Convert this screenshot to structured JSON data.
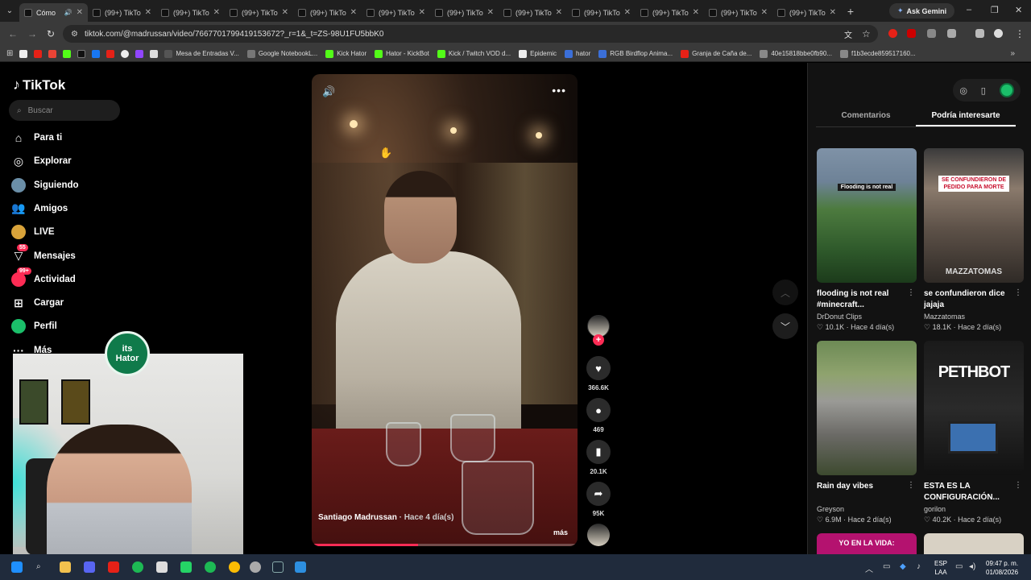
{
  "browser": {
    "tabs": [
      {
        "label": "Cómo"
      },
      {
        "label": "(99+) TikTo"
      },
      {
        "label": "(99+) TikTo"
      },
      {
        "label": "(99+) TikTo"
      },
      {
        "label": "(99+) TikTo"
      },
      {
        "label": "(99+) TikTo"
      },
      {
        "label": "(99+) TikTo"
      },
      {
        "label": "(99+) TikTo"
      },
      {
        "label": "(99+) TikTo"
      },
      {
        "label": "(99+) TikTo"
      },
      {
        "label": "(99+) TikTo"
      },
      {
        "label": "(99+) TikTo"
      }
    ],
    "gemini_label": "Ask Gemini",
    "url": "tiktok.com/@madrussan/video/7667701799419153672?_r=1&_t=ZS-98U1FU5bbK0",
    "bookmarks": [
      {
        "label": "Mesa de Entradas V...",
        "color": "#555555"
      },
      {
        "label": "Google NotebookL...",
        "color": "#777777"
      },
      {
        "label": "Kick Hator",
        "color": "#53fc18"
      },
      {
        "label": "Hator - KickBot",
        "color": "#53fc18"
      },
      {
        "label": "Kick / Twitch VOD d...",
        "color": "#53fc18"
      },
      {
        "label": "Epidemic",
        "color": "#eeeeee"
      },
      {
        "label": "hator",
        "color": "#3b6fd8"
      },
      {
        "label": "RGB Birdflop Anima...",
        "color": "#3b6fd8"
      },
      {
        "label": "Granja de Caña de...",
        "color": "#e62117"
      },
      {
        "label": "40e15818bbe0fb90...",
        "color": "#888888"
      },
      {
        "label": "f1b3ecde859517160...",
        "color": "#888888"
      }
    ]
  },
  "sidebar": {
    "brand": "TikTok",
    "search_placeholder": "Buscar",
    "items": [
      {
        "label": "Para ti",
        "icon": "home-icon"
      },
      {
        "label": "Explorar",
        "icon": "compass-icon"
      },
      {
        "label": "Siguiendo",
        "icon": "following-avatar-icon"
      },
      {
        "label": "Amigos",
        "icon": "friends-icon"
      },
      {
        "label": "LIVE",
        "icon": "live-icon"
      },
      {
        "label": "Mensajes",
        "icon": "messages-icon",
        "badge": "55"
      },
      {
        "label": "Actividad",
        "icon": "activity-icon",
        "badge": "99+"
      },
      {
        "label": "Cargar",
        "icon": "upload-icon"
      },
      {
        "label": "Perfil",
        "icon": "profile-icon"
      },
      {
        "label": "Más",
        "icon": "more-icon"
      }
    ]
  },
  "video": {
    "author": "Santiago Madrussan",
    "ago": "· Hace 4 día(s)",
    "more_label": "más",
    "progress": 0.4,
    "likes": "366.6K",
    "comments": "469",
    "saves": "20.1K",
    "shares": "95K"
  },
  "right_panel": {
    "tabs": [
      "Comentarios",
      "Podría interesarte"
    ],
    "active_tab": 1,
    "cards": [
      {
        "title": "flooding is not real #minecraft...",
        "author": "DrDonut Clips",
        "likes": "10.1K",
        "ago": "Hace 4 día(s)",
        "overlay": "Flooding is not real"
      },
      {
        "title": "se confundieron dice jajaja",
        "author": "Mazzatomas",
        "likes": "18.1K",
        "ago": "Hace 2 día(s)",
        "overlay": "SE CONFUNDIERON DE PEDIDO PARA MORTE",
        "watermark": "MAZZATOMAS"
      },
      {
        "title": "Rain day vibes",
        "author": "Greyson",
        "likes": "6.9M",
        "ago": "Hace 2 día(s)"
      },
      {
        "title": "ESTA ES LA CONFIGURACIÓN...",
        "author": "gorilon",
        "likes": "40.2K",
        "ago": "Hace 2 día(s)",
        "overlay": "PETHBOT"
      }
    ],
    "partial_card_text": "YO EN LA VIDA:"
  },
  "webcam": {
    "logo_line1": "its",
    "logo_line2": "Hator"
  },
  "taskbar": {
    "lang1": "ESP",
    "lang2": "LAA",
    "time": "09:47 p. m.",
    "date": "01/08/2026"
  }
}
